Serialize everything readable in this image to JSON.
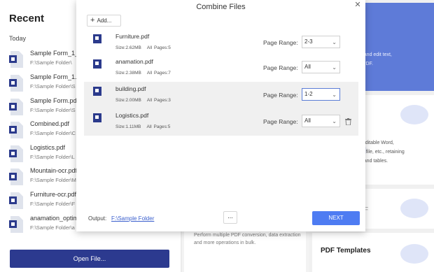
{
  "recent": {
    "title": "Recent",
    "section": "Today",
    "items": [
      {
        "name": "Sample Form_1_O",
        "path": "F:\\Sample Folder\\"
      },
      {
        "name": "Sample Form_1.pd",
        "path": "F:\\Sample Folder\\S"
      },
      {
        "name": "Sample Form.pdf",
        "path": "F:\\Sample Folder\\S"
      },
      {
        "name": "Combined.pdf",
        "path": "F:\\Sample Folder\\C"
      },
      {
        "name": "Logistics.pdf",
        "path": "F:\\Sample Folder\\L"
      },
      {
        "name": "Mountain-ocr.pdf",
        "path": "F:\\Sample Folder\\M"
      },
      {
        "name": "Furniture-ocr.pdf",
        "path": "F:\\Sample Folder\\F"
      },
      {
        "name": "anamation_optim",
        "path": "F:\\Sample Folder\\a"
      }
    ],
    "open_file_label": "Open File..."
  },
  "middle": {
    "card_text": "Perform multiple PDF conversion, data extraction and more operations in bulk."
  },
  "right": {
    "edit_card_lines": [
      "e, and edit text,",
      "n PDF."
    ],
    "convert_card_lines": [
      "n editable Word,",
      "cel file, etc., retaining",
      "g, and tables."
    ],
    "batch_letter": "F",
    "templates_title": "PDF Templates"
  },
  "modal": {
    "title": "Combine Files",
    "add_label": "Add...",
    "range_label": "Page Range:",
    "files": [
      {
        "name": "Furniture.pdf",
        "size": "Size:2.62MB",
        "pages": "All Pages:5",
        "range": "2-3"
      },
      {
        "name": "anamation.pdf",
        "size": "Size:2.38MB",
        "pages": "All Pages:7",
        "range": "All"
      },
      {
        "name": "building.pdf",
        "size": "Size:2.00MB",
        "pages": "All Pages:3",
        "range": "1-2"
      },
      {
        "name": "Logistics.pdf",
        "size": "Size:1.11MB",
        "pages": "All Pages:5",
        "range": "All"
      }
    ],
    "output_label": "Output:",
    "output_path": "F:\\Sample Folder",
    "browse_label": "...",
    "next_label": "NEXT"
  },
  "colors": {
    "accent_blue": "#4e7cf2",
    "open_file_button": "#2c3a8f",
    "right_card_blue": "#5e7bd8",
    "link": "#3a5fcd"
  }
}
